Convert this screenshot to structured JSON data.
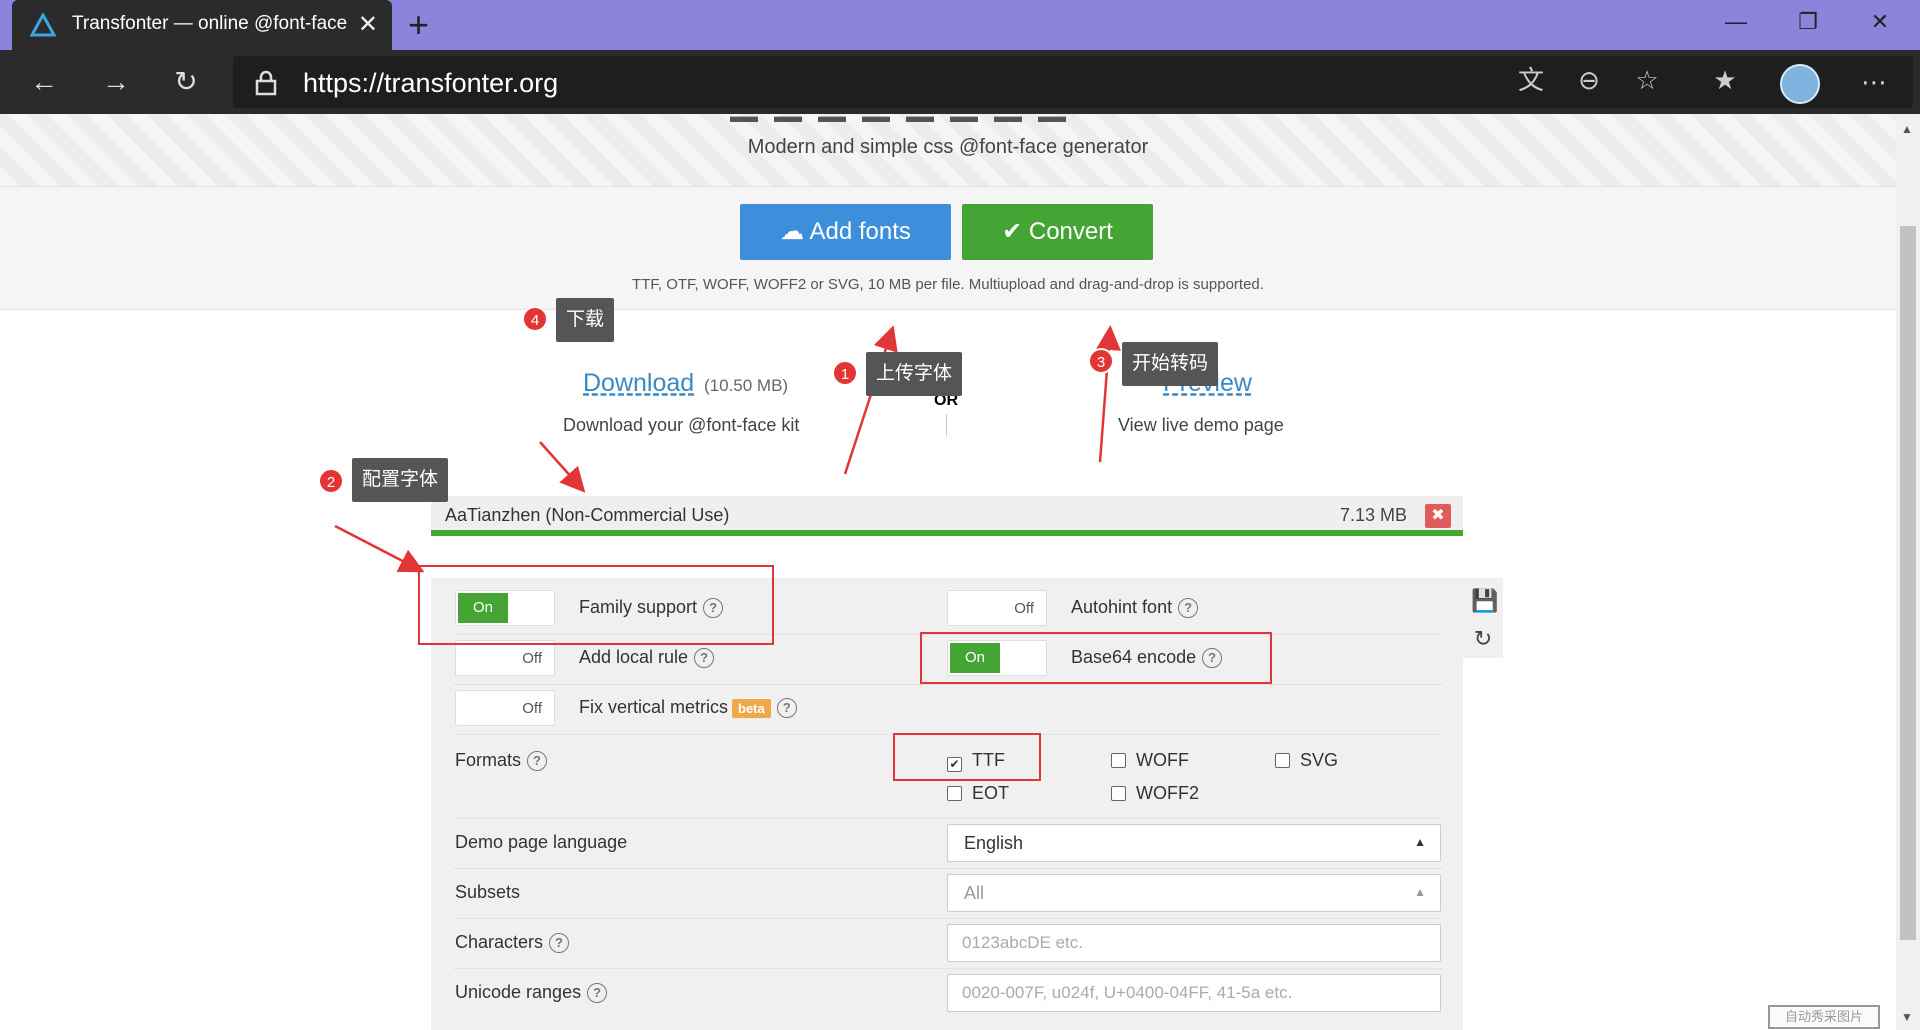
{
  "browser": {
    "tab_title": "Transfonter — online @font-face",
    "url": "https://transfonter.org",
    "new_tab": "+",
    "close": "✕",
    "minimize": "—",
    "restore": "❐",
    "window_close": "✕",
    "more": "⋯"
  },
  "hero": {
    "subtitle": "Modern and simple css @font-face generator",
    "add_fonts": "Add fonts",
    "convert": "Convert",
    "hint": "TTF, OTF, WOFF, WOFF2 or SVG, 10 MB per file. Multiupload and drag-and-drop is supported."
  },
  "result": {
    "download_label": "Download",
    "download_size": "(10.50 MB)",
    "download_desc": "Download your @font-face kit",
    "or": "OR",
    "preview_label": "Preview",
    "preview_desc": "View live demo page"
  },
  "font_file": {
    "name": "AaTianzhen (Non-Commercial Use)",
    "size": "7.13 MB"
  },
  "settings": {
    "family_support": {
      "label": "Family support",
      "state": "On"
    },
    "autohint_font": {
      "label": "Autohint font",
      "state": "Off"
    },
    "add_local_rule": {
      "label": "Add local rule",
      "state": "Off"
    },
    "base64_encode": {
      "label": "Base64 encode",
      "state": "On"
    },
    "fix_vertical_metrics": {
      "label": "Fix vertical metrics",
      "state": "Off",
      "badge": "beta"
    },
    "formats_label": "Formats",
    "formats": [
      {
        "label": "TTF",
        "checked": true
      },
      {
        "label": "WOFF",
        "checked": false
      },
      {
        "label": "SVG",
        "checked": false
      },
      {
        "label": "EOT",
        "checked": false
      },
      {
        "label": "WOFF2",
        "checked": false
      }
    ],
    "demo_language_label": "Demo page language",
    "demo_language_value": "English",
    "subsets_label": "Subsets",
    "subsets_value": "All",
    "characters_label": "Characters",
    "characters_placeholder": "0123abcDE etc.",
    "unicode_label": "Unicode ranges",
    "unicode_placeholder": "0020-007F, u024f, U+0400-04FF, 41-5a etc.",
    "help": "?"
  },
  "annotations": [
    {
      "num": "1",
      "text": "上传字体"
    },
    {
      "num": "2",
      "text": "配置字体"
    },
    {
      "num": "3",
      "text": "开始转码"
    },
    {
      "num": "4",
      "text": "下载"
    }
  ],
  "watermark": "自动秀采图片",
  "colors": {
    "primary": "#3d8edb",
    "success": "#45a534",
    "danger": "#e05c5c",
    "annotation": "#e23535"
  }
}
